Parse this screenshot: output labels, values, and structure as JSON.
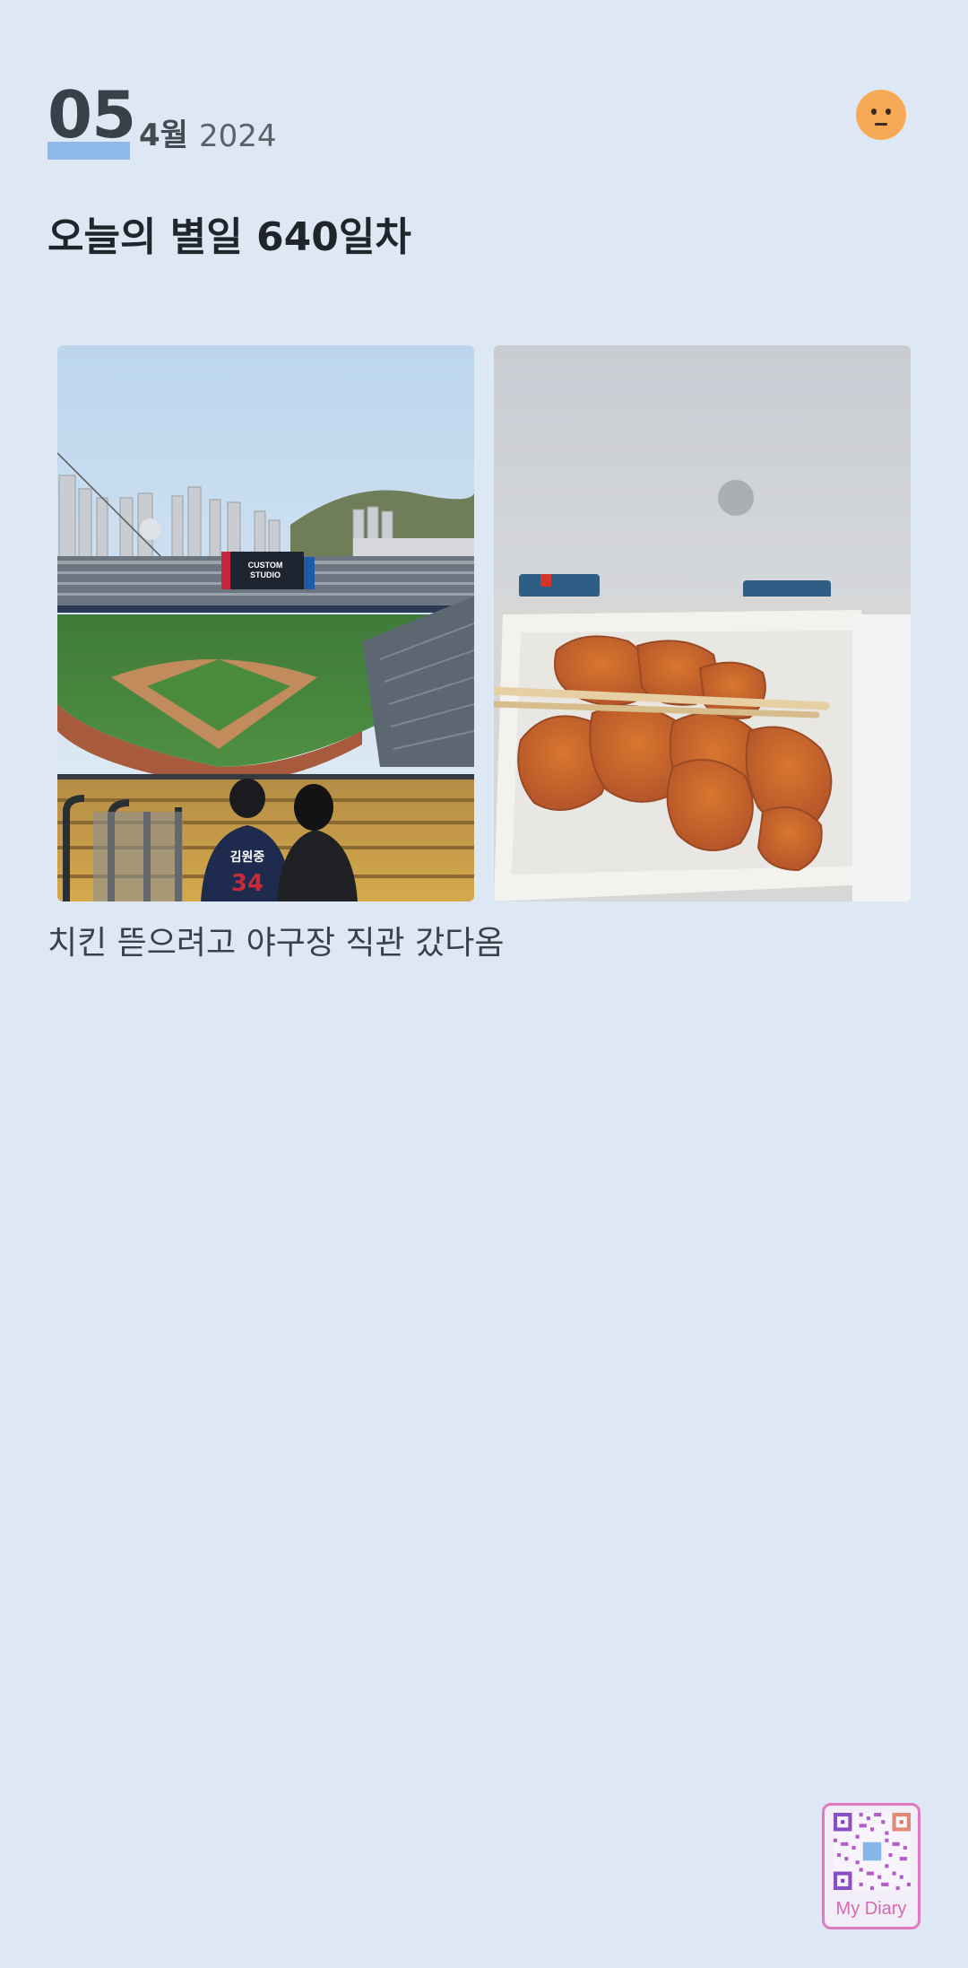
{
  "header": {
    "day": "05",
    "month": "4월",
    "year": "2024",
    "mood_icon": "neutral-face-icon",
    "mood_color": "#f6a955",
    "highlight_color": "#8fb8ea"
  },
  "entry": {
    "title": "오늘의 별일 640일차",
    "caption": "치킨 뜯으려고 야구장 직관 갔다옴"
  },
  "photos": [
    {
      "name": "baseball-stadium-photo",
      "scoreboard": "CUSTOM STUDIO",
      "jersey": "김원중"
    },
    {
      "name": "fried-chicken-photo"
    }
  ],
  "badge": {
    "label": "My Diary",
    "icon": "qr-code-icon",
    "color": "#e079c0"
  },
  "colors": {
    "background": "#dee8f4"
  }
}
